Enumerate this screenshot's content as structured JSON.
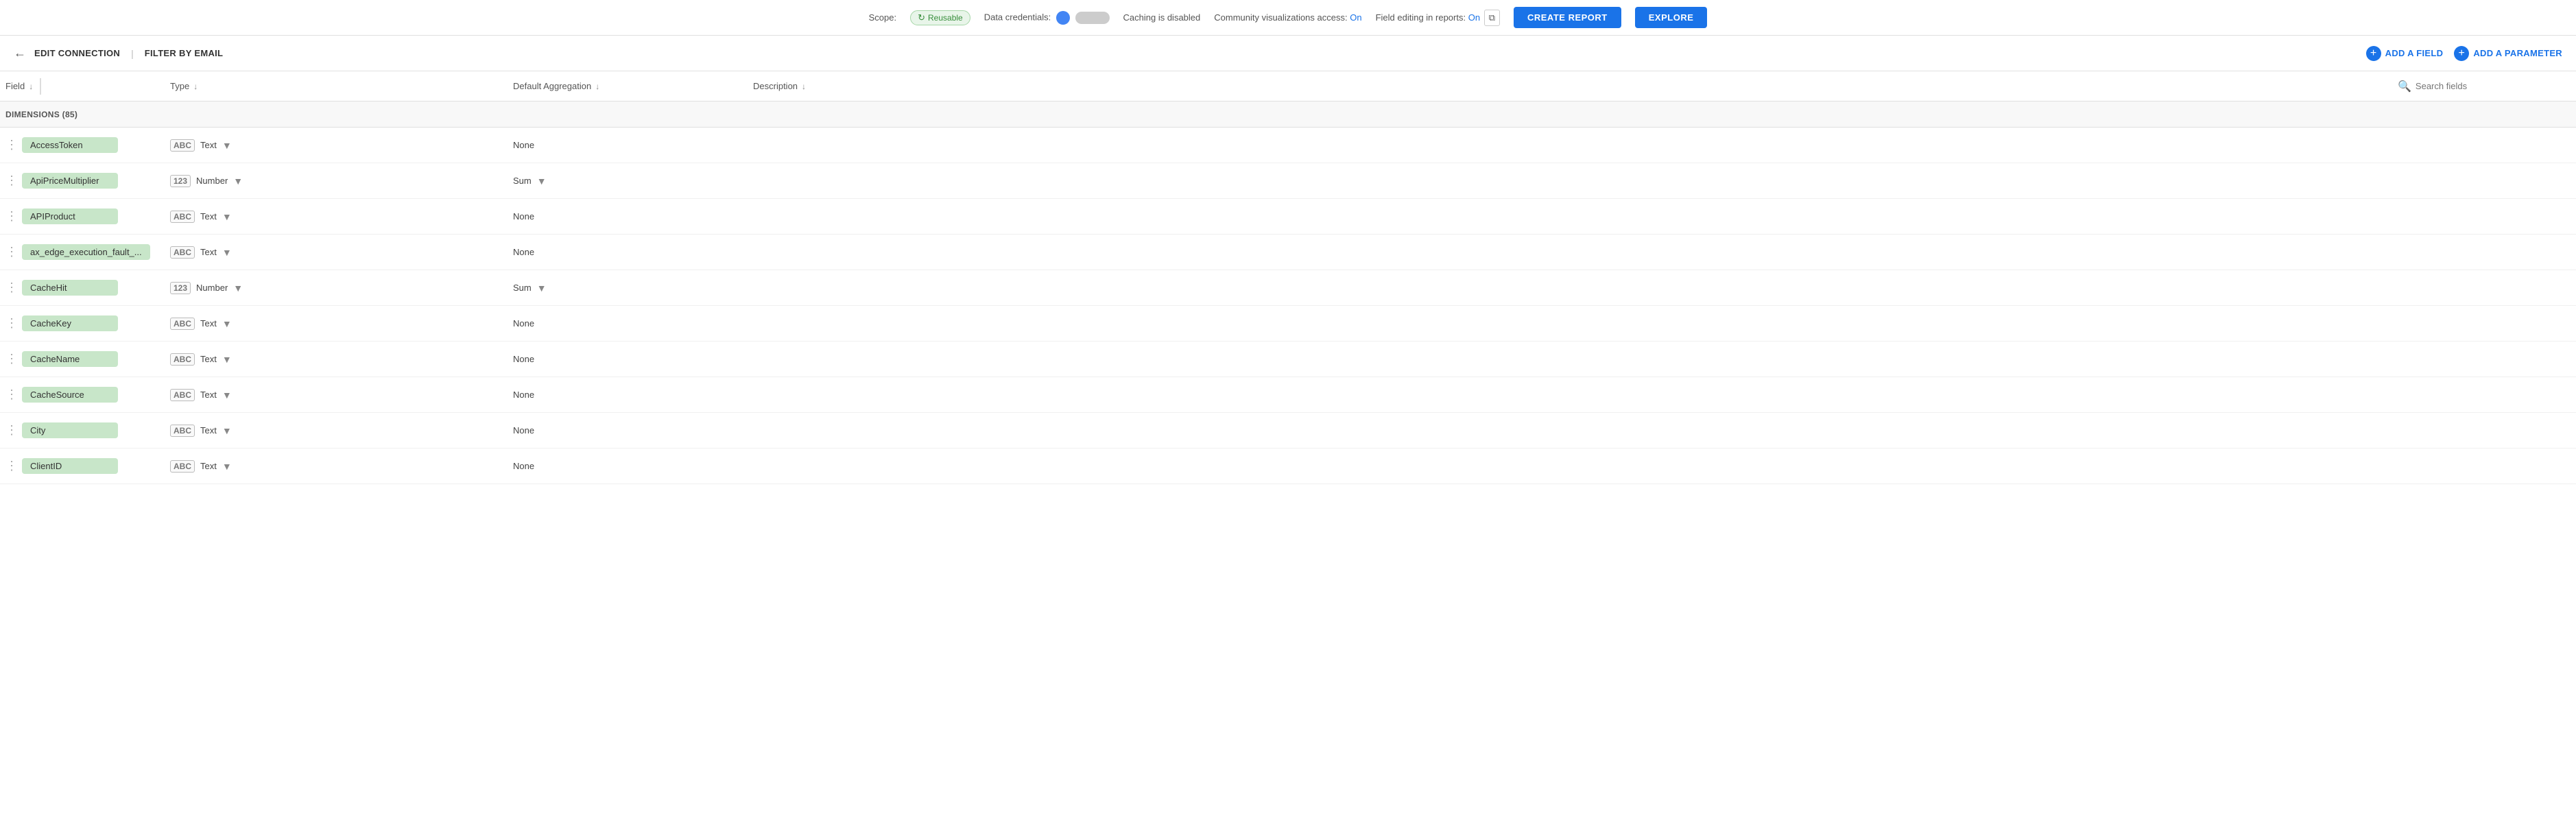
{
  "topbar": {
    "scope_label": "Scope:",
    "reusable_label": "Reusable",
    "data_credentials_label": "Data credentials:",
    "caching_label": "Caching is disabled",
    "community_label": "Community visualizations access:",
    "community_on": "On",
    "field_editing_label": "Field editing in reports:",
    "field_editing_on": "On",
    "create_report_label": "CREATE REPORT",
    "explore_label": "EXPLORE"
  },
  "secondbar": {
    "back_label": "←",
    "edit_conn_label": "EDIT CONNECTION",
    "divider": "|",
    "filter_label": "FILTER BY EMAIL",
    "add_field_label": "ADD A FIELD",
    "add_param_label": "ADD A PARAMETER"
  },
  "tableheader": {
    "field_col": "Field",
    "type_col": "Type",
    "agg_col": "Default Aggregation",
    "desc_col": "Description",
    "search_placeholder": "Search fields"
  },
  "section": {
    "label": "DIMENSIONS (85)"
  },
  "rows": [
    {
      "name": "AccessToken",
      "type_icon": "ABC",
      "type": "Text",
      "agg": "None",
      "agg_has_dropdown": false,
      "desc": ""
    },
    {
      "name": "ApiPriceMultiplier",
      "type_icon": "123",
      "type": "Number",
      "agg": "Sum",
      "agg_has_dropdown": true,
      "desc": ""
    },
    {
      "name": "APIProduct",
      "type_icon": "ABC",
      "type": "Text",
      "agg": "None",
      "agg_has_dropdown": false,
      "desc": ""
    },
    {
      "name": "ax_edge_execution_fault_...",
      "type_icon": "ABC",
      "type": "Text",
      "agg": "None",
      "agg_has_dropdown": false,
      "desc": ""
    },
    {
      "name": "CacheHit",
      "type_icon": "123",
      "type": "Number",
      "agg": "Sum",
      "agg_has_dropdown": true,
      "desc": ""
    },
    {
      "name": "CacheKey",
      "type_icon": "ABC",
      "type": "Text",
      "agg": "None",
      "agg_has_dropdown": false,
      "desc": ""
    },
    {
      "name": "CacheName",
      "type_icon": "ABC",
      "type": "Text",
      "agg": "None",
      "agg_has_dropdown": false,
      "desc": ""
    },
    {
      "name": "CacheSource",
      "type_icon": "ABC",
      "type": "Text",
      "agg": "None",
      "agg_has_dropdown": false,
      "desc": ""
    },
    {
      "name": "City",
      "type_icon": "ABC",
      "type": "Text",
      "agg": "None",
      "agg_has_dropdown": false,
      "desc": ""
    },
    {
      "name": "ClientID",
      "type_icon": "ABC",
      "type": "Text",
      "agg": "None",
      "agg_has_dropdown": false,
      "desc": ""
    }
  ]
}
